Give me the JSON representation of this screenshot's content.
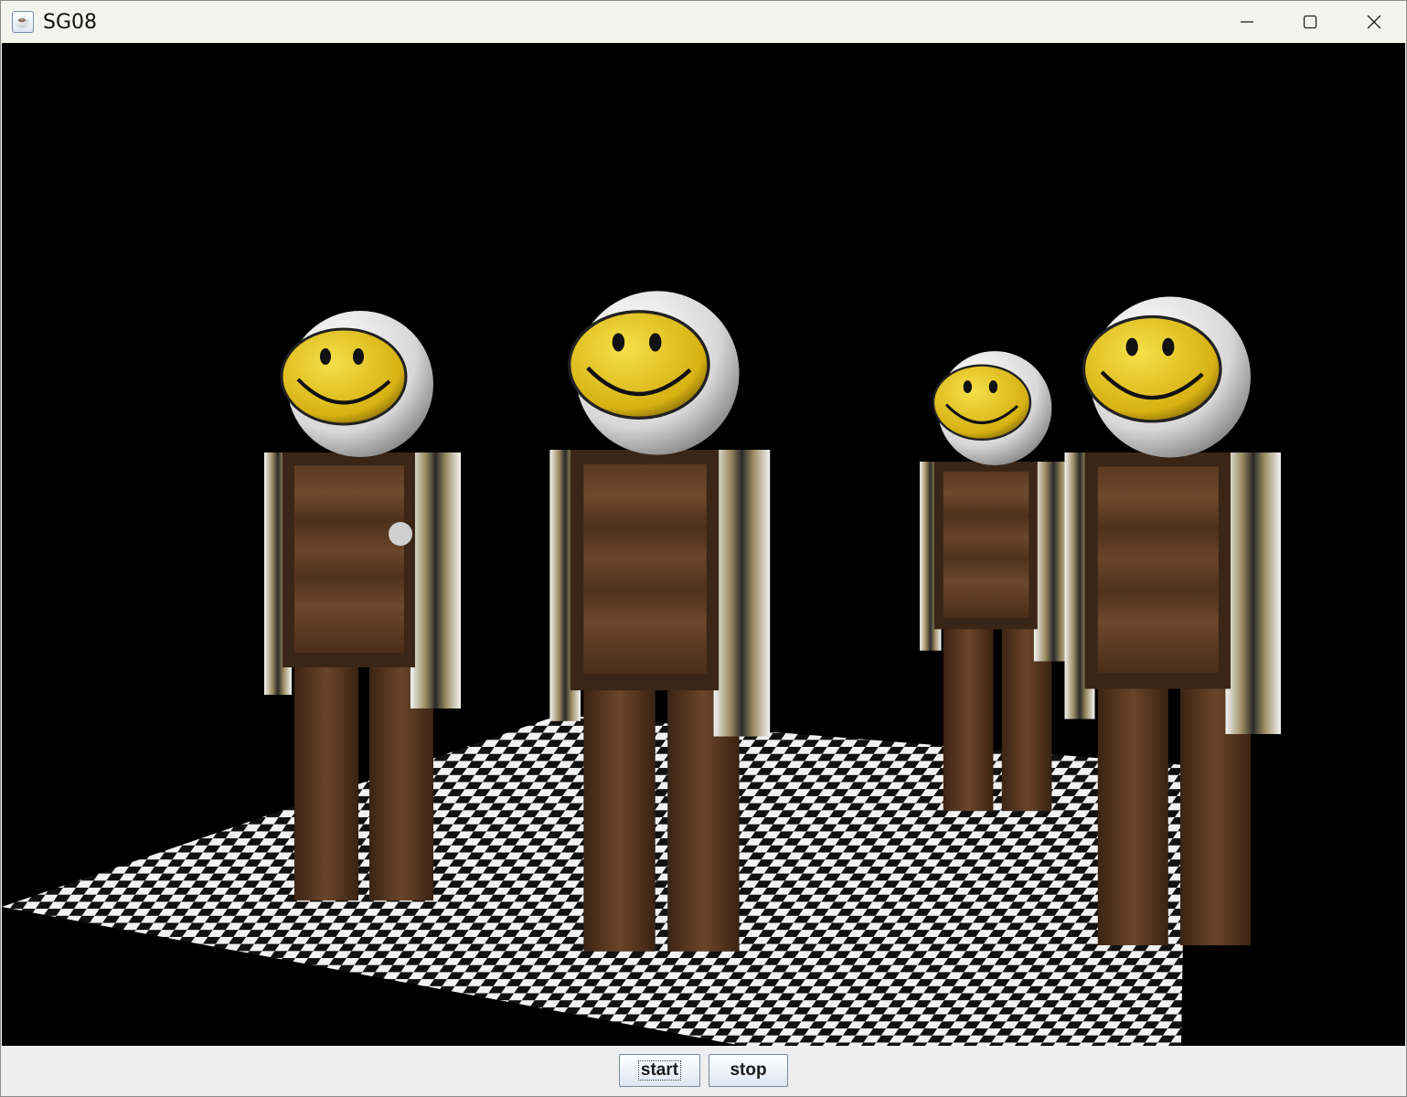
{
  "window": {
    "title": "SG08",
    "app_icon": "java-coffee-icon"
  },
  "window_controls": {
    "minimize_icon": "minimize-icon",
    "maximize_icon": "maximize-icon",
    "close_icon": "close-icon"
  },
  "scene": {
    "background_color": "#000000",
    "floor": "checkerboard",
    "figures": [
      {
        "head": "smiley-sphere",
        "torso": "wood-crate",
        "legs": "wood-planks"
      },
      {
        "head": "smiley-sphere",
        "torso": "wood-crate",
        "legs": "wood-planks"
      },
      {
        "head": "smiley-sphere",
        "torso": "wood-crate",
        "legs": "wood-planks"
      },
      {
        "head": "smiley-sphere",
        "torso": "wood-crate",
        "legs": "wood-planks"
      }
    ]
  },
  "controls": {
    "start_label": "start",
    "stop_label": "stop"
  }
}
